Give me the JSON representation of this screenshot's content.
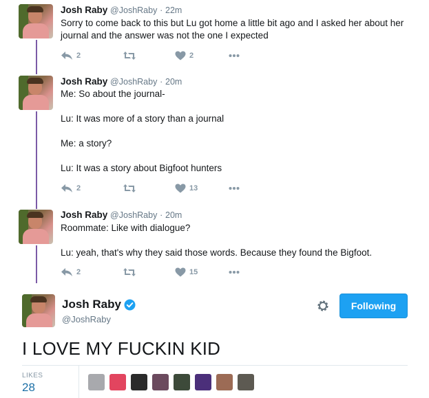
{
  "thread": [
    {
      "name": "Josh Raby",
      "handle": "@JoshRaby",
      "sep": "·",
      "time": "22m",
      "paragraphs": [
        "Sorry to come back to this but Lu got home a little bit ago and I asked her about her journal and the answer was not the one I expected"
      ],
      "replies": "2",
      "retweets": "",
      "likes": "2"
    },
    {
      "name": "Josh Raby",
      "handle": "@JoshRaby",
      "sep": "·",
      "time": "20m",
      "paragraphs": [
        "Me: So about the journal-",
        "Lu: It was more of a story than a journal",
        "Me: a story?",
        "Lu: It was a story about Bigfoot hunters"
      ],
      "replies": "2",
      "retweets": "",
      "likes": "13"
    },
    {
      "name": "Josh Raby",
      "handle": "@JoshRaby",
      "sep": "·",
      "time": "20m",
      "paragraphs": [
        "Roommate: Like with dialogue?",
        "Lu: yeah, that's why they said those words. Because they found the Bigfoot."
      ],
      "replies": "2",
      "retweets": "",
      "likes": "15"
    }
  ],
  "main_tweet": {
    "name": "Josh Raby",
    "handle": "@JoshRaby",
    "follow_label": "Following",
    "text": "I LOVE MY FUCKIN KID",
    "likes_label": "LIKES",
    "likes_count": "28",
    "liker_colors": [
      "#a8a9ad",
      "#e2455f",
      "#2b2b2b",
      "#6b4a5e",
      "#3d4a3a",
      "#4b2f7a",
      "#9c6b55",
      "#5d5a52"
    ]
  },
  "colors": {
    "thread_line": "#7b5aa6",
    "accent": "#1da1f2",
    "muted": "#8899a6"
  },
  "icons": [
    "reply-icon",
    "retweet-icon",
    "heart-icon",
    "more-icon",
    "verified-icon",
    "gear-icon"
  ]
}
